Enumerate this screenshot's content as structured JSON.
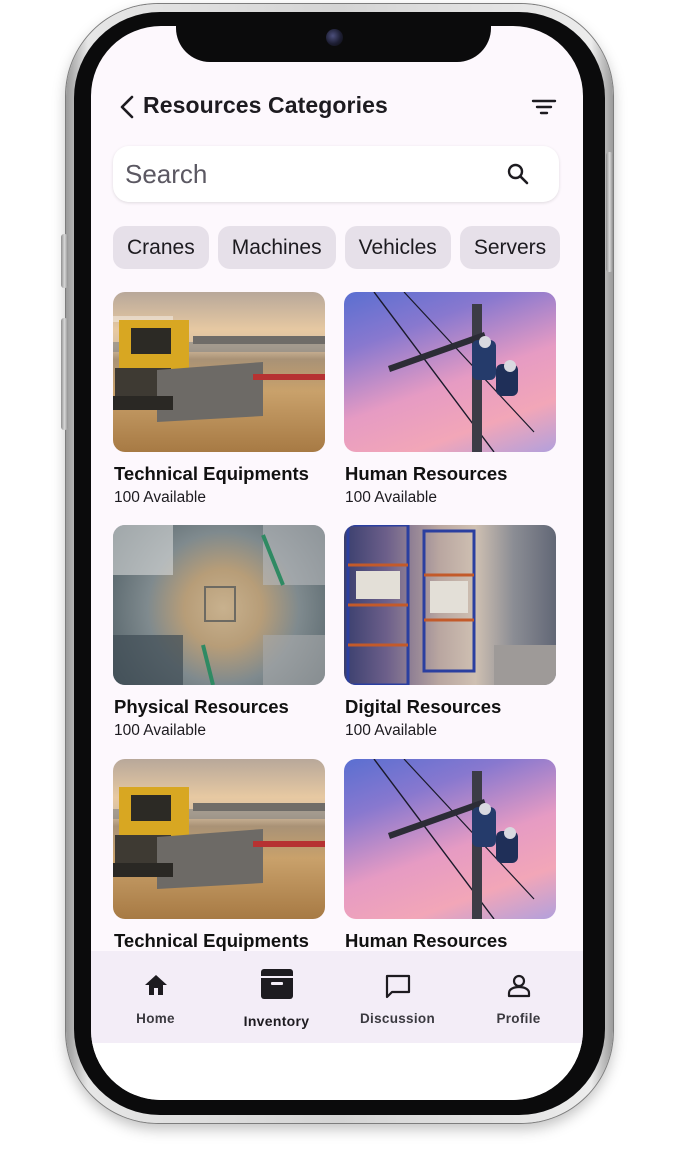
{
  "header": {
    "title": "Resources Categories",
    "back_icon": "chevron-left-icon",
    "filter_icon": "filter-lines-icon"
  },
  "search": {
    "placeholder": "Search",
    "value": "",
    "icon": "search-icon"
  },
  "chips": [
    "Cranes",
    "Machines",
    "Vehicles",
    "Servers"
  ],
  "cards": [
    {
      "title": "Technical Equipments",
      "count": "100 Available",
      "image": "bulldozer-photo"
    },
    {
      "title": "Human Resources",
      "count": "100 Available",
      "image": "power-line-workers-photo"
    },
    {
      "title": "Physical Resources",
      "count": "100 Available",
      "image": "aerial-construction-site-photo"
    },
    {
      "title": "Digital Resources",
      "count": "100 Available",
      "image": "warehouse-shelves-photo"
    },
    {
      "title": "Technical Equipments",
      "count": "",
      "image": "bulldozer-photo"
    },
    {
      "title": "Human Resources",
      "count": "",
      "image": "power-line-workers-photo"
    }
  ],
  "bottom_nav": {
    "items": [
      {
        "label": "Home",
        "icon": "home-icon",
        "active": false
      },
      {
        "label": "Inventory",
        "icon": "archive-box-icon",
        "active": true
      },
      {
        "label": "Discussion",
        "icon": "chat-bubble-icon",
        "active": false
      },
      {
        "label": "Profile",
        "icon": "person-icon",
        "active": false
      }
    ]
  },
  "colors": {
    "background": "#fdf8fd",
    "chip": "#e6e0e9",
    "nav_bar": "#f3edf7",
    "text": "#1d1b20"
  }
}
